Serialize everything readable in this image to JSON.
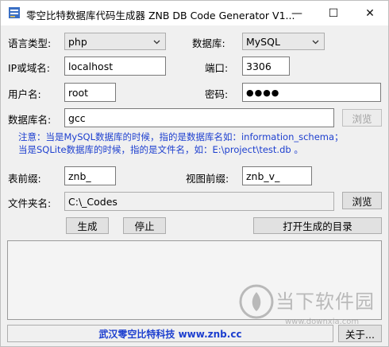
{
  "window": {
    "title": "零空比特数据库代码生成器 ZNB DB Code Generator V1...",
    "minimize_glyph": "—",
    "maximize_glyph": "☐",
    "close_glyph": "✕"
  },
  "form": {
    "language_label": "语言类型:",
    "language_value": "php",
    "database_label": "数据库:",
    "database_value": "MySQL",
    "host_label": "IP或域名:",
    "host_value": "localhost",
    "port_label": "端口:",
    "port_value": "3306",
    "user_label": "用户名:",
    "user_value": "root",
    "password_label": "密码:",
    "password_value": "●●●●",
    "dbname_label": "数据库名:",
    "dbname_value": "gcc",
    "browse_db_label": "浏览",
    "note_line1": "注意：当是MySQL数据库的时候，指的是数据库名如：information_schema；",
    "note_line2": "当是SQLite数据库的时候，指的是文件名，如：E:\\project\\test.db 。",
    "table_prefix_label": "表前缀:",
    "table_prefix_value": "znb_",
    "view_prefix_label": "视图前缀:",
    "view_prefix_value": "znb_v_",
    "folder_label": "文件夹名:",
    "folder_value": "C:\\_Codes",
    "browse_folder_label": "浏览"
  },
  "actions": {
    "generate_label": "生成",
    "stop_label": "停止",
    "open_dir_label": "打开生成的目录"
  },
  "status": {
    "company": "武汉零空比特科技 www.znb.cc",
    "about_label": "关于..."
  },
  "watermark": {
    "text": "当下软件园",
    "url": "www.downxia.com"
  }
}
